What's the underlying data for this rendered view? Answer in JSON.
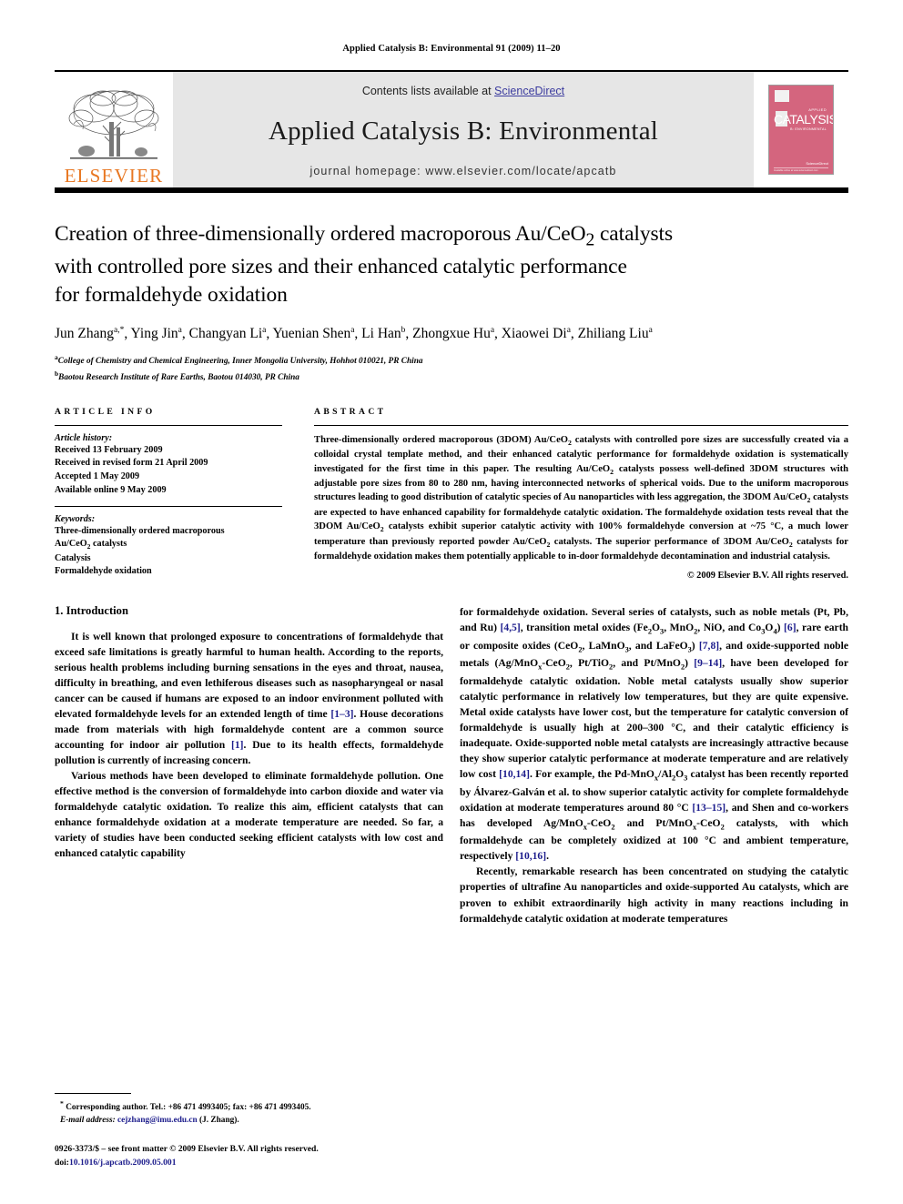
{
  "running_head": "Applied Catalysis B: Environmental 91 (2009) 11–20",
  "banner": {
    "publisher_logo_text": "ELSEVIER",
    "contents_prefix": "Contents lists available at ",
    "contents_link": "ScienceDirect",
    "journal_title": "Applied Catalysis B: Environmental",
    "homepage": "journal homepage: www.elsevier.com/locate/apcatb",
    "cover": {
      "applied": "APPLIED",
      "main": "CATALYSIS",
      "sub": "B: ENVIRONMENTAL",
      "sciencedirect": "ScienceDirect",
      "tiny": "Available online at www.sciencedirect.com"
    },
    "accent_orange": "#E87722",
    "cover_color": "#d4657e",
    "link_color": "#3b3b9e",
    "band_color": "#e6e6e6"
  },
  "article": {
    "title": "Creation of three-dimensionally ordered macroporous Au/CeO2 catalysts with controlled pore sizes and their enhanced catalytic performance for formaldehyde oxidation",
    "title_lines": [
      "Creation of three-dimensionally ordered macroporous Au/CeO",
      "with controlled pore sizes and their enhanced catalytic performance",
      "for formaldehyde oxidation"
    ],
    "title_sub": "2",
    "title_line1_tail": " catalysts",
    "authors": [
      {
        "name": "Jun Zhang",
        "marks": "a,*"
      },
      {
        "name": "Ying Jin",
        "marks": "a"
      },
      {
        "name": "Changyan Li",
        "marks": "a"
      },
      {
        "name": "Yuenian Shen",
        "marks": "a"
      },
      {
        "name": "Li Han",
        "marks": "b"
      },
      {
        "name": "Zhongxue Hu",
        "marks": "a"
      },
      {
        "name": "Xiaowei Di",
        "marks": "a"
      },
      {
        "name": "Zhiliang Liu",
        "marks": "a"
      }
    ],
    "affiliations": [
      {
        "mark": "a",
        "text": "College of Chemistry and Chemical Engineering, Inner Mongolia University, Hohhot 010021, PR China"
      },
      {
        "mark": "b",
        "text": "Baotou Research Institute of Rare Earths, Baotou 014030, PR China"
      }
    ]
  },
  "article_info": {
    "heading": "ARTICLE INFO",
    "history_label": "Article history:",
    "history": [
      "Received 13 February 2009",
      "Received in revised form 21 April 2009",
      "Accepted 1 May 2009",
      "Available online 9 May 2009"
    ],
    "keywords_label": "Keywords:",
    "keywords": [
      "Three-dimensionally ordered macroporous",
      "Au/CeO2 catalysts",
      "Catalysis",
      "Formaldehyde oxidation"
    ]
  },
  "abstract": {
    "heading": "ABSTRACT",
    "text_html": "Three-dimensionally ordered macroporous (3DOM) Au/CeO<sub>2</sub> catalysts with controlled pore sizes are successfully created via a colloidal crystal template method, and their enhanced catalytic performance for formaldehyde oxidation is systematically investigated for the first time in this paper. The resulting Au/CeO<sub>2</sub> catalysts possess well-defined 3DOM structures with adjustable pore sizes from 80 to 280 nm, having interconnected networks of spherical voids. Due to the uniform macroporous structures leading to good distribution of catalytic species of Au nanoparticles with less aggregation, the 3DOM Au/CeO<sub>2</sub> catalysts are expected to have enhanced capability for formaldehyde catalytic oxidation. The formaldehyde oxidation tests reveal that the 3DOM Au/CeO<sub>2</sub> catalysts exhibit superior catalytic activity with 100% formaldehyde conversion at ~75 °C, a much lower temperature than previously reported powder Au/CeO<sub>2</sub> catalysts. The superior performance of 3DOM Au/CeO<sub>2</sub> catalysts for formaldehyde oxidation makes them potentially applicable to in-door formaldehyde decontamination and industrial catalysis.",
    "copyright": "© 2009 Elsevier B.V. All rights reserved."
  },
  "body": {
    "section_title": "1. Introduction",
    "left_paragraphs_html": [
      "It is well known that prolonged exposure to concentrations of formaldehyde that exceed safe limitations is greatly harmful to human health. According to the reports, serious health problems including burning sensations in the eyes and throat, nausea, difficulty in breathing, and even lethiferous diseases such as nasopharyngeal or nasal cancer can be caused if humans are exposed to an indoor environment polluted with elevated formaldehyde levels for an extended length of time <span class=\"ref\">[1–3]</span>. House decorations made from materials with high formaldehyde content are a common source accounting for indoor air pollution <span class=\"ref\">[1]</span>. Due to its health effects, formaldehyde pollution is currently of increasing concern.",
      "Various methods have been developed to eliminate formaldehyde pollution. One effective method is the conversion of formaldehyde into carbon dioxide and water via formaldehyde catalytic oxidation. To realize this aim, efficient catalysts that can enhance formaldehyde oxidation at a moderate temperature are needed. So far, a variety of studies have been conducted seeking efficient catalysts with low cost and enhanced catalytic capability"
    ],
    "right_paragraphs_html": [
      "for formaldehyde oxidation. Several series of catalysts, such as noble metals (Pt, Pb, and Ru) <span class=\"ref\">[4,5]</span>, transition metal oxides (Fe<sub>2</sub>O<sub>3</sub>, MnO<sub>2</sub>, NiO, and Co<sub>3</sub>O<sub>4</sub>) <span class=\"ref\">[6]</span>, rare earth or composite oxides (CeO<sub>2</sub>, LaMnO<sub>3</sub>, and LaFeO<sub>3</sub>) <span class=\"ref\">[7,8]</span>, and oxide-supported noble metals (Ag/MnO<sub>x</sub>-CeO<sub>2</sub>, Pt/TiO<sub>2</sub>, and Pt/MnO<sub>2</sub>) <span class=\"ref\">[9–14]</span>, have been developed for formaldehyde catalytic oxidation. Noble metal catalysts usually show superior catalytic performance in relatively low temperatures, but they are quite expensive. Metal oxide catalysts have lower cost, but the temperature for catalytic conversion of formaldehyde is usually high at 200–300 °C, and their catalytic efficiency is inadequate. Oxide-supported noble metal catalysts are increasingly attractive because they show superior catalytic performance at moderate temperature and are relatively low cost <span class=\"ref\">[10,14]</span>. For example, the Pd-MnO<sub>x</sub>/Al<sub>2</sub>O<sub>3</sub> catalyst has been recently reported by Álvarez-Galván et al. to show superior catalytic activity for complete formaldehyde oxidation at moderate temperatures around 80 °C <span class=\"ref\">[13–15]</span>, and Shen and co-workers has developed Ag/MnO<sub>x</sub>-CeO<sub>2</sub> and Pt/MnO<sub>x</sub>-CeO<sub>2</sub> catalysts, with which formaldehyde can be completely oxidized at 100 °C and ambient temperature, respectively <span class=\"ref\">[10,16]</span>.",
      "Recently, remarkable research has been concentrated on studying the catalytic properties of ultrafine Au nanoparticles and oxide-supported Au catalysts, which are proven to exhibit extraordinarily high activity in many reactions including in formaldehyde catalytic oxidation at moderate temperatures"
    ]
  },
  "footnotes": {
    "corresponding_html": "<sup>*</sup> Corresponding author. Tel.: +86 471 4993405; fax: +86 471 4993405.",
    "email_html": "<span class=\"em\">E-mail address:</span> <span class=\"fn-link\">cejzhang@imu.edu.cn</span> (J. Zhang).",
    "issn_html": "0926-3373/$ – see front matter © 2009 Elsevier B.V. All rights reserved.",
    "doi_html": "doi:<span class=\"fn-link\">10.1016/j.apcatb.2009.05.001</span>"
  }
}
